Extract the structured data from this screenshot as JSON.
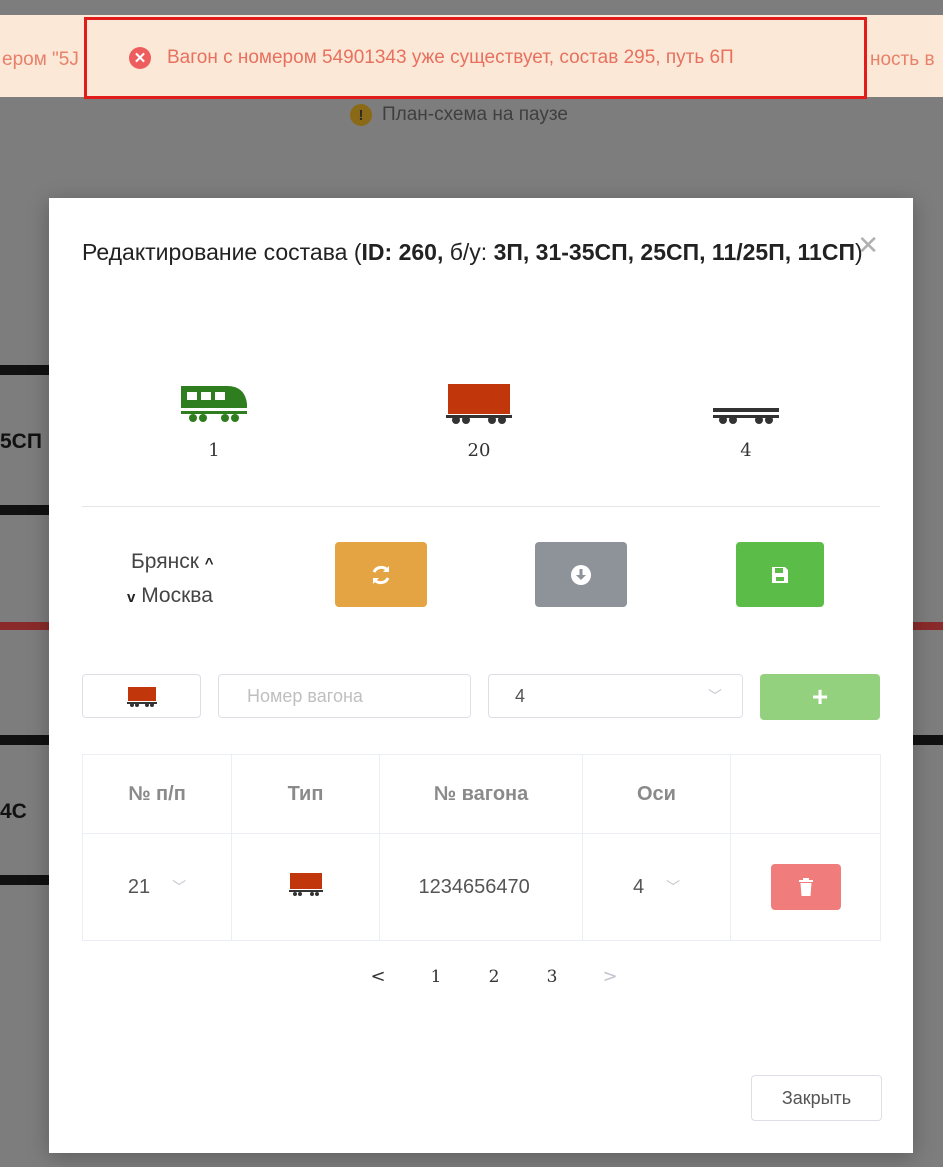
{
  "toast": {
    "message": "Вагон с номером 54901343 уже существует, состав 295, путь 6П",
    "left_overflow": "ером \"5Ј",
    "right_overflow": "ность в",
    "icon": "error-circle-icon"
  },
  "background": {
    "pause_text": "План-схема на паузе",
    "labels": [
      "5СП",
      "4С"
    ]
  },
  "modal": {
    "title_prefix": "Редактирование состава (",
    "title_id": "ID: 260,",
    "title_mid": " б/у: ",
    "title_tracks": "3П, 31-35СП, 25СП, 11/25П, 11СП",
    "title_suffix": ")",
    "close_icon": "close-icon"
  },
  "stats": [
    {
      "icon": "locomotive-icon",
      "value": "1",
      "color": "#2e7d1e"
    },
    {
      "icon": "freight-wagon-icon",
      "value": "20",
      "color": "#c2360b"
    },
    {
      "icon": "flatcar-icon",
      "value": "4",
      "color": "#333333"
    }
  ],
  "route": {
    "from": "Брянск",
    "to": "Москва"
  },
  "actions": {
    "sync_icon": "refresh-icon",
    "download_icon": "download-icon",
    "save_icon": "save-icon"
  },
  "add_form": {
    "type_icon": "freight-wagon-icon",
    "wagon_number_placeholder": "Номер вагона",
    "axles_value": "4",
    "add_label": "+"
  },
  "table": {
    "headers": [
      "№ п/п",
      "Тип",
      "№ вагона",
      "Оси",
      ""
    ],
    "rows": [
      {
        "index": "21",
        "type_icon": "freight-wagon-icon",
        "wagon_number": "1234656470",
        "axles": "4"
      }
    ]
  },
  "pagination": {
    "prev": "<",
    "pages": [
      "1",
      "2",
      "3"
    ],
    "next": ">"
  },
  "footer": {
    "close_label": "Закрыть"
  }
}
